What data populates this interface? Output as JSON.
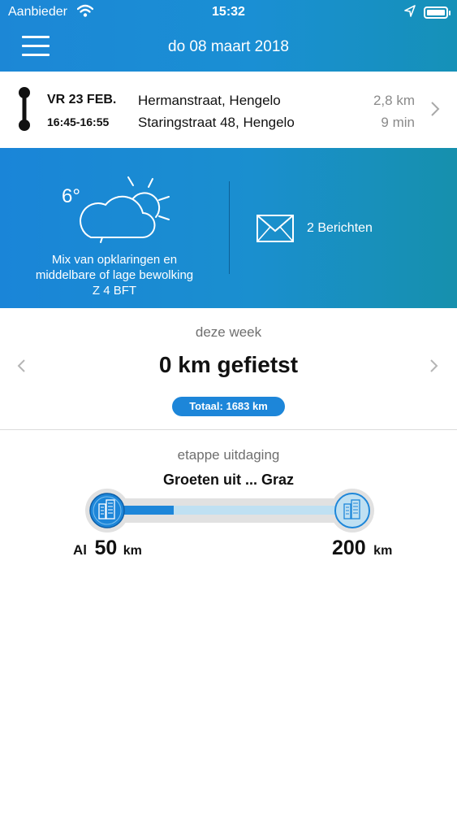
{
  "status_bar": {
    "carrier": "Aanbieder",
    "time": "15:32"
  },
  "header": {
    "date_title": "do 08 maart 2018"
  },
  "trip": {
    "date": "VR 23 FEB.",
    "time_range": "16:45-16:55",
    "from": "Hermanstraat, Hengelo",
    "to": "Staringstraat  48, Hengelo",
    "distance": "2,8 km",
    "duration": "9 min"
  },
  "weather": {
    "temperature": "6°",
    "description": "Mix van opklaringen en middelbare of lage bewolking",
    "wind": "Z 4 BFT"
  },
  "messages": {
    "label": "2 Berichten"
  },
  "week": {
    "label": "deze week",
    "km_cycled": "0 km gefietst",
    "total": "Totaal: 1683 km"
  },
  "challenge": {
    "label": "etappe uitdaging",
    "title": "Groeten uit ... Graz",
    "start_prefix": "Al",
    "start_value": "50",
    "start_unit": "km",
    "end_value": "200",
    "end_unit": "km",
    "progress_fraction": 0.25
  },
  "colors": {
    "primary_blue": "#1c87d6",
    "teal_blue": "#1591b8",
    "progress_fill": "#1d86d9",
    "progress_track": "#bfe0f2"
  }
}
